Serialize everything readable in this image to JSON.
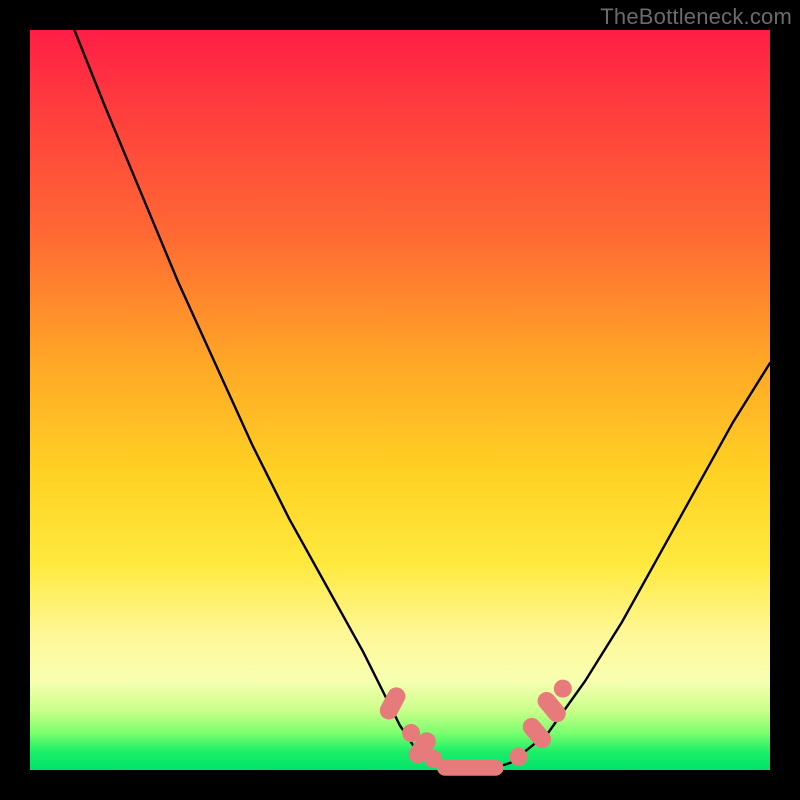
{
  "watermark": "TheBottleneck.com",
  "chart_data": {
    "type": "line",
    "title": "",
    "xlabel": "",
    "ylabel": "",
    "xlim": [
      0,
      100
    ],
    "ylim": [
      0,
      100
    ],
    "grid": false,
    "legend": false,
    "series": [
      {
        "name": "bottleneck-curve",
        "x": [
          6,
          10,
          15,
          20,
          25,
          30,
          35,
          40,
          45,
          48,
          50,
          52,
          55,
          58,
          60,
          62,
          65,
          70,
          75,
          80,
          85,
          90,
          95,
          100
        ],
        "y": [
          100,
          90,
          78,
          66,
          55,
          44,
          34,
          25,
          16,
          10,
          6,
          3,
          1,
          0,
          0,
          0,
          1,
          5,
          12,
          20,
          29,
          38,
          47,
          55
        ]
      }
    ],
    "markers": [
      {
        "name": "left-cluster-1",
        "shape": "pill",
        "x": 49.0,
        "y": 9.0,
        "angle": -62
      },
      {
        "name": "left-cluster-2",
        "shape": "circle",
        "x": 51.5,
        "y": 5.0
      },
      {
        "name": "left-cluster-3",
        "shape": "pill",
        "x": 53.0,
        "y": 3.0,
        "angle": -55
      },
      {
        "name": "left-cluster-4",
        "shape": "circle",
        "x": 54.5,
        "y": 1.5
      },
      {
        "name": "floor-bar",
        "shape": "bar",
        "x1": 55.0,
        "x2": 64.0,
        "y": 0.3
      },
      {
        "name": "right-dot",
        "shape": "circle",
        "x": 66.0,
        "y": 1.8
      },
      {
        "name": "right-cluster-1",
        "shape": "pill",
        "x": 68.5,
        "y": 5.0,
        "angle": 50
      },
      {
        "name": "right-cluster-2",
        "shape": "pill",
        "x": 70.5,
        "y": 8.5,
        "angle": 50
      },
      {
        "name": "right-cluster-3",
        "shape": "circle",
        "x": 72.0,
        "y": 11.0
      }
    ],
    "marker_color": "#e77b7b",
    "curve_color": "#000000"
  }
}
